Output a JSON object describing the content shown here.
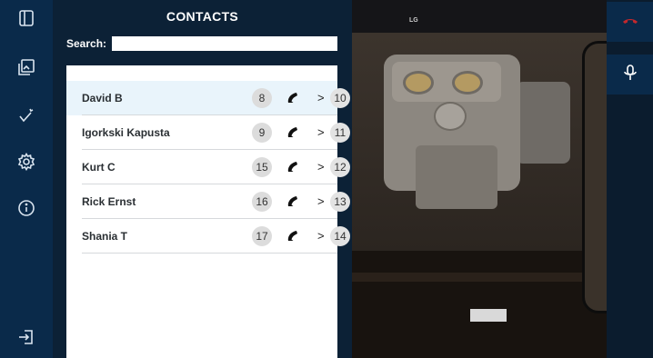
{
  "panel": {
    "title": "CONTACTS",
    "search_label": "Search:",
    "search_value": "",
    "search_placeholder": ""
  },
  "contacts": [
    {
      "name": "David B",
      "number": "8",
      "extension": "10",
      "selected": true
    },
    {
      "name": "Igorkski Kapusta",
      "number": "9",
      "extension": "11",
      "selected": false
    },
    {
      "name": "Kurt C",
      "number": "15",
      "extension": "12",
      "selected": false
    },
    {
      "name": "Rick Ernst",
      "number": "16",
      "extension": "13",
      "selected": false
    },
    {
      "name": "Shania T",
      "number": "17",
      "extension": "14",
      "selected": false
    }
  ],
  "row_chevron": ">",
  "left_rail": [
    "sidebar-toggle-icon",
    "gallery-icon",
    "checklist-icon",
    "settings-icon",
    "info-icon",
    "logout-icon"
  ],
  "right_rail": [
    "end-call-icon",
    "microphone-icon"
  ],
  "camera": {
    "overlay_text": "LG"
  },
  "colors": {
    "rail": "#0a2a4a",
    "panel": "#0c2136",
    "selected_row": "#e9f4fb",
    "end_call": "#c0282d"
  }
}
